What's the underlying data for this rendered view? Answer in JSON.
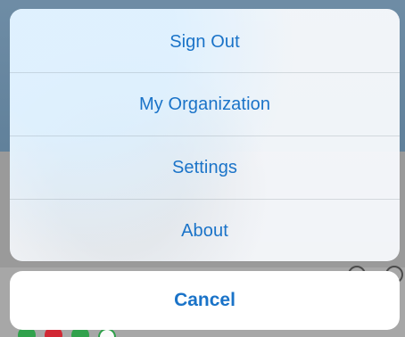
{
  "action_sheet": {
    "items": [
      {
        "label": "Sign Out"
      },
      {
        "label": "My Organization"
      },
      {
        "label": "Settings"
      },
      {
        "label": "About"
      }
    ],
    "cancel_label": "Cancel"
  },
  "colors": {
    "accent": "#1a73c8",
    "sheet_background": "#f5f8fc",
    "cancel_background": "#ffffff",
    "backdrop": "#8e8e8e"
  }
}
